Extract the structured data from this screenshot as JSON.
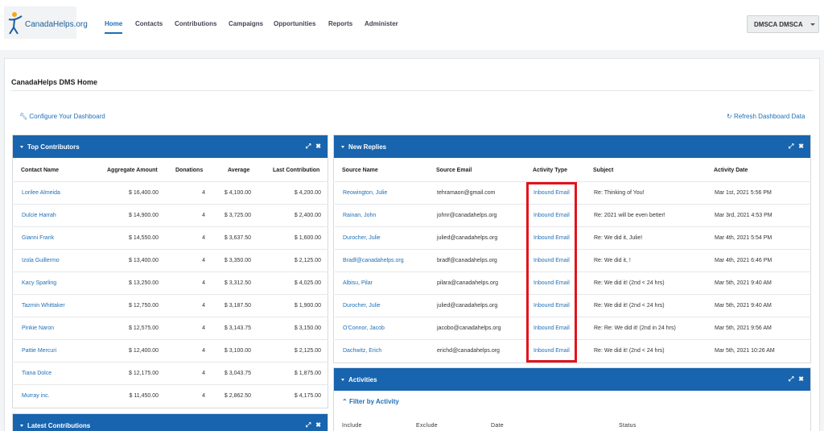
{
  "brand": {
    "logo_text": "CanadaHelps.org"
  },
  "nav": [
    "Home",
    "Contacts",
    "Contributions",
    "Campaigns",
    "Opportunities",
    "Reports",
    "Administer"
  ],
  "user_menu": "DMSCA DMSCA",
  "page_title": "CanadaHelps DMS Home",
  "configure_label": "Configure Your Dashboard",
  "refresh_label": "Refresh Dashboard Data",
  "top_contributors": {
    "title": "Top Contributors",
    "columns": [
      "Contact Name",
      "Aggregate Amount",
      "Donations",
      "Average",
      "Last Contribution"
    ],
    "rows": [
      [
        "Lorilee Almeida",
        "$ 16,400.00",
        "4",
        "$ 4,100.00",
        "$ 4,200.00"
      ],
      [
        "Dulcie Harrah",
        "$ 14,900.00",
        "4",
        "$ 3,725.00",
        "$ 2,400.00"
      ],
      [
        "Gianni Frank",
        "$ 14,550.00",
        "4",
        "$ 3,637.50",
        "$ 1,600.00"
      ],
      [
        "Izola Guillermo",
        "$ 13,400.00",
        "4",
        "$ 3,350.00",
        "$ 2,125.00"
      ],
      [
        "Kacy Sparling",
        "$ 13,250.00",
        "4",
        "$ 3,312.50",
        "$ 4,025.00"
      ],
      [
        "Tazmin Whittaker",
        "$ 12,750.00",
        "4",
        "$ 3,187.50",
        "$ 1,900.00"
      ],
      [
        "Pinkie Naron",
        "$ 12,575.00",
        "4",
        "$ 3,143.75",
        "$ 3,150.00"
      ],
      [
        "Pattie Mercuri",
        "$ 12,400.00",
        "4",
        "$ 3,100.00",
        "$ 2,125.00"
      ],
      [
        "Tiana Dolce",
        "$ 12,175.00",
        "4",
        "$ 3,043.75",
        "$ 1,875.00"
      ],
      [
        "Murray inc.",
        "$ 11,450.00",
        "4",
        "$ 2,862.50",
        "$ 4,175.00"
      ]
    ]
  },
  "latest_contributions": {
    "title": "Latest Contributions"
  },
  "new_replies": {
    "title": "New Replies",
    "columns": [
      "Source Name",
      "Source Email",
      "Activity Type",
      "Subject",
      "Activity Date"
    ],
    "rows": [
      [
        "Reowington, Julie",
        "tehramaon@gmail.com",
        "Inbound Email",
        "Re: Thinking of You!",
        "Mar 1st, 2021 5:56 PM"
      ],
      [
        "Rainan, John",
        "johnr@canadahelps.org",
        "Inbound Email",
        "Re: 2021 will be even better!",
        "Mar 3rd, 2021 4:53 PM"
      ],
      [
        "Durocher, Julie",
        "julied@canadahelps.org",
        "Inbound Email",
        "Re: We did it, Julie!",
        "Mar 4th, 2021 5:54 PM"
      ],
      [
        "Bradf@canadahelps.org",
        "bradf@canadahelps.org",
        "Inbound Email",
        "Re: We did it, !",
        "Mar 4th, 2021 6:46 PM"
      ],
      [
        "Albisu, Pilar",
        "pilara@canadahelps.org",
        "Inbound Email",
        "Re: We did it! (2nd < 24 hrs)",
        "Mar 5th, 2021 9:40 AM"
      ],
      [
        "Durocher, Julie",
        "julied@canadahelps.org",
        "Inbound Email",
        "Re: We did it! (2nd < 24 hrs)",
        "Mar 5th, 2021 9:40 AM"
      ],
      [
        "O'Connor, Jacob",
        "jacobo@canadahelps.org",
        "Inbound Email",
        "Re: Re: We did it! (2nd in 24 hrs)",
        "Mar 5th, 2021 9:56 AM"
      ],
      [
        "Dachwitz, Erich",
        "erichd@canadahelps.org",
        "Inbound Email",
        "Re: We did it! (2nd < 24 hrs)",
        "Mar 5th, 2021 10:26 AM"
      ]
    ]
  },
  "activities": {
    "title": "Activities",
    "filter_label": "Filter by Activity",
    "filter_fields": [
      "Include",
      "Exclude",
      "Date",
      "Status"
    ]
  },
  "colors": {
    "panel_header": "#1864ae",
    "link": "#1f6fb7",
    "highlight": "#e0141b"
  }
}
